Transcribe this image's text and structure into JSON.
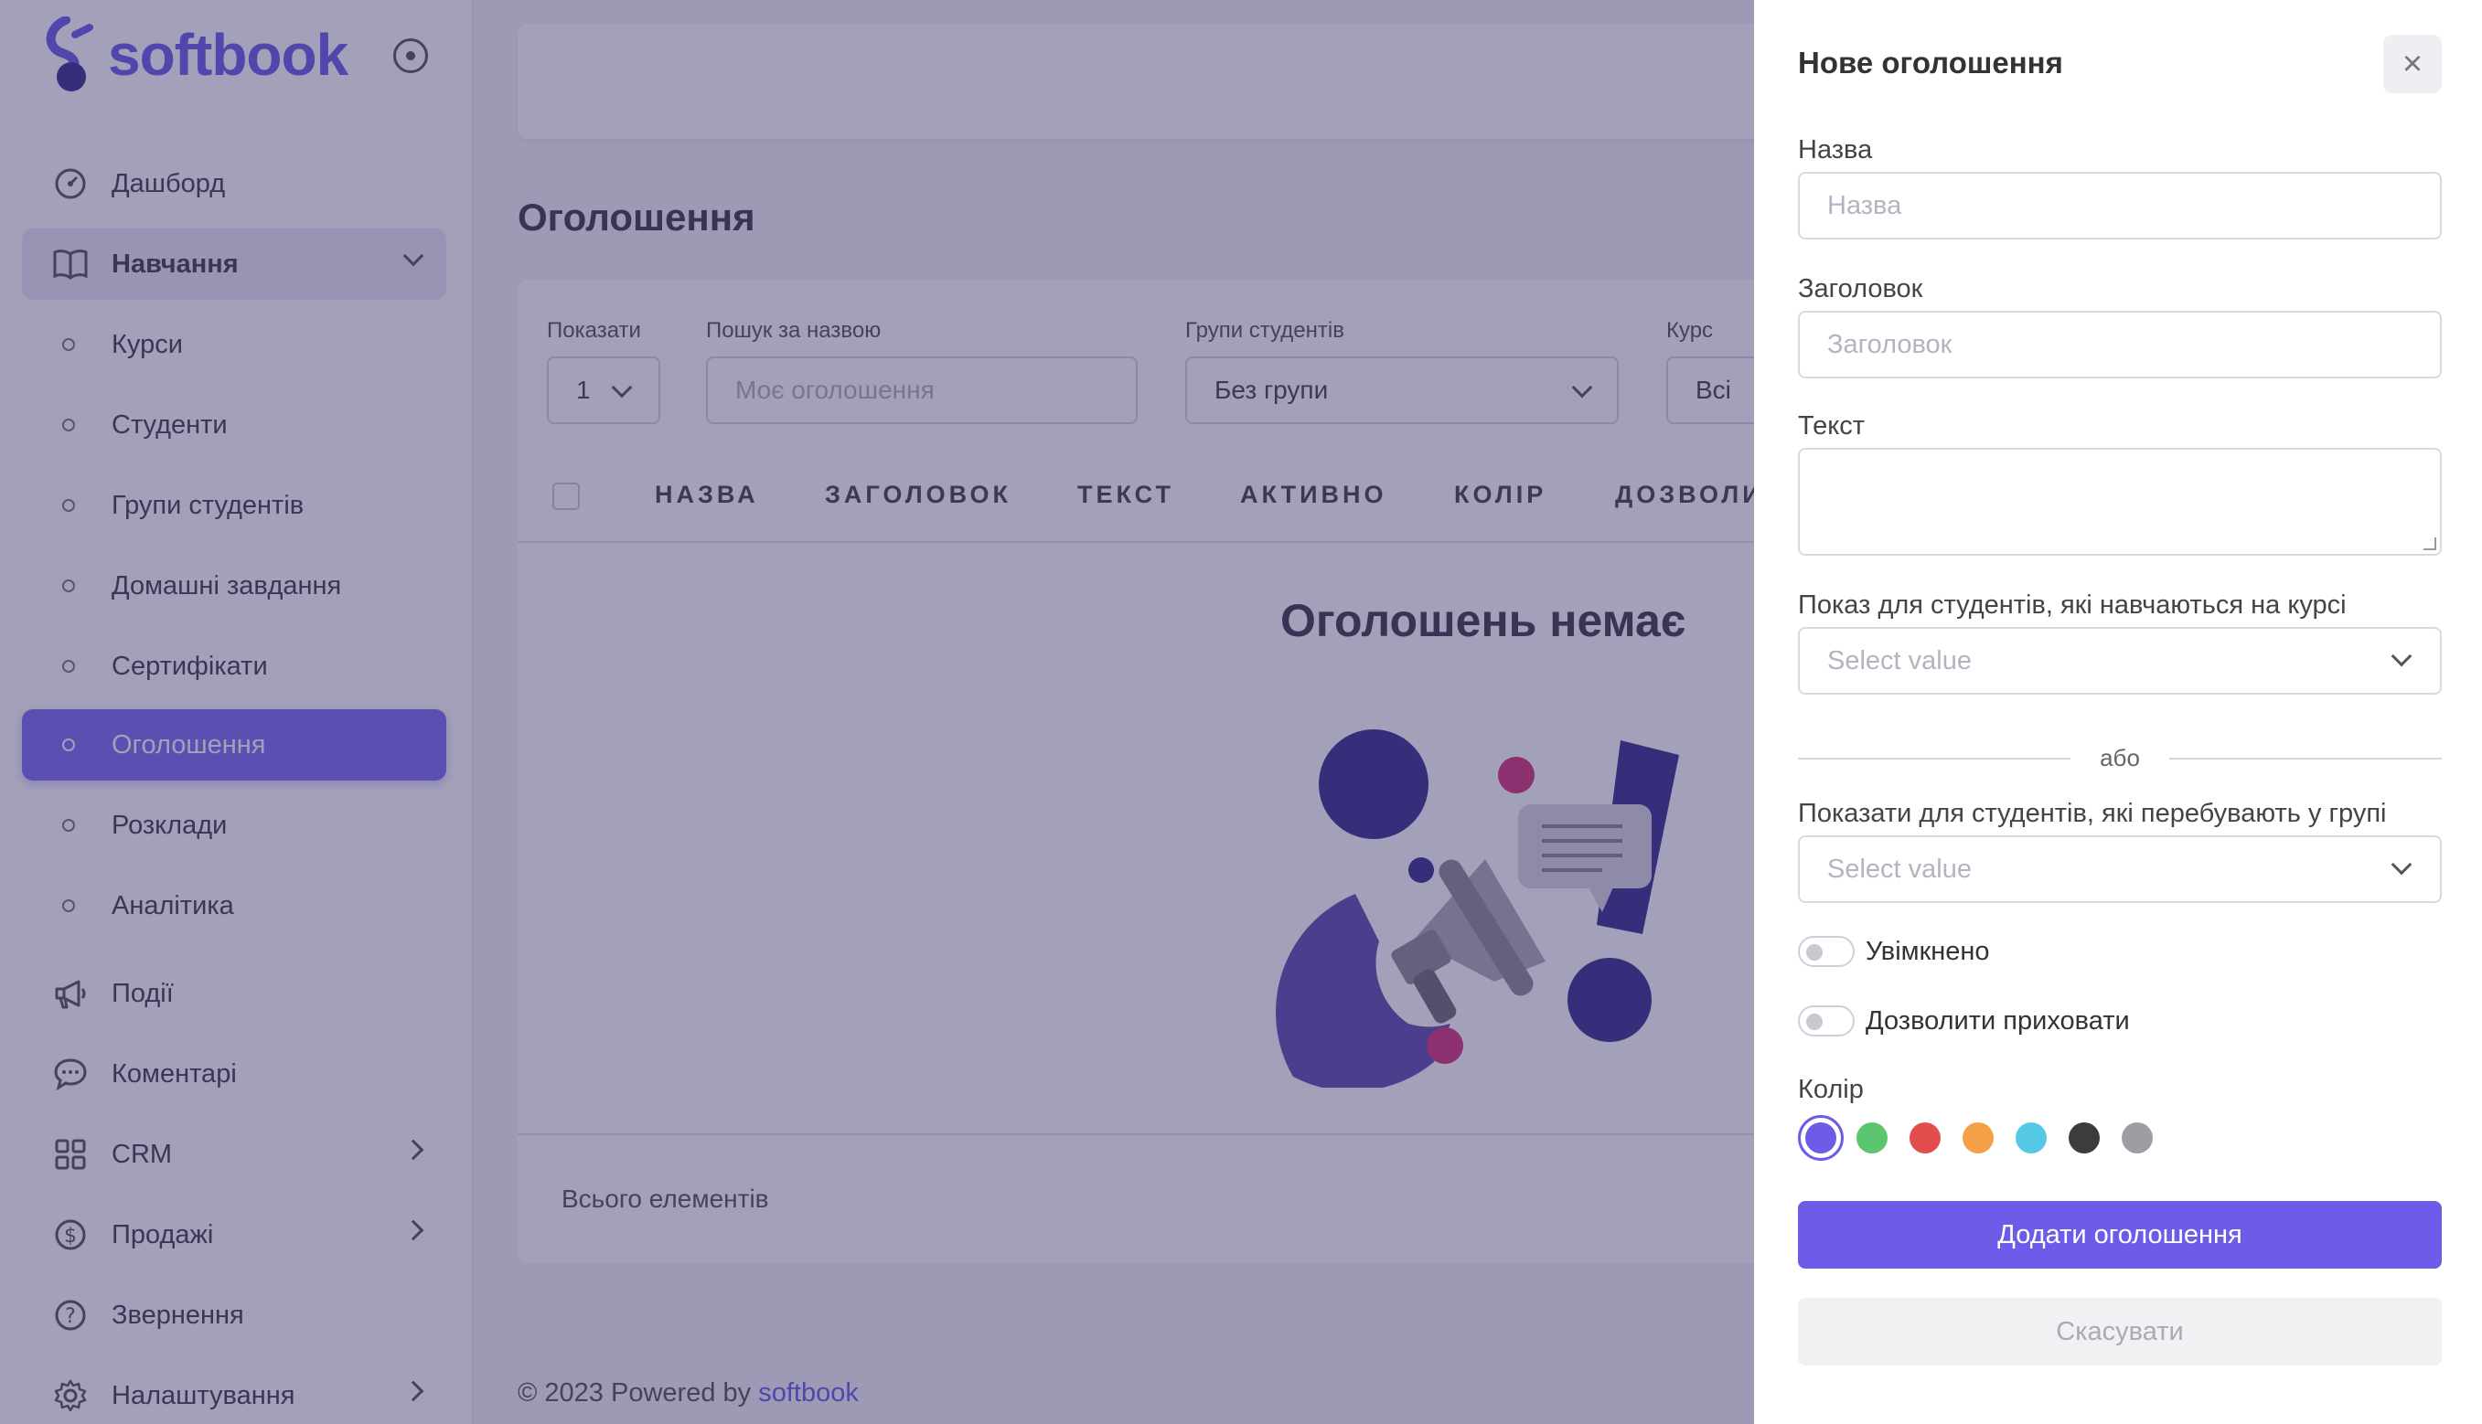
{
  "brand": {
    "name": "softbook",
    "accent": "#6c5ce7"
  },
  "sidebar": {
    "items": [
      {
        "label": "Дашборд",
        "icon": "dashboard-icon"
      },
      {
        "label": "Навчання",
        "icon": "book-icon",
        "expanded": true
      },
      {
        "label": "Курси"
      },
      {
        "label": "Студенти"
      },
      {
        "label": "Групи студентів"
      },
      {
        "label": "Домашні завдання"
      },
      {
        "label": "Сертифікати"
      },
      {
        "label": "Оголошення",
        "active": true
      },
      {
        "label": "Розклади"
      },
      {
        "label": "Аналітика"
      },
      {
        "label": "Події",
        "icon": "megaphone-icon"
      },
      {
        "label": "Коментарі",
        "icon": "comment-icon"
      },
      {
        "label": "CRM",
        "icon": "grid-icon"
      },
      {
        "label": "Продажі",
        "icon": "dollar-icon"
      },
      {
        "label": "Звернення",
        "icon": "help-icon"
      },
      {
        "label": "Налаштування",
        "icon": "gear-icon"
      }
    ]
  },
  "main": {
    "title": "Оголошення",
    "filters": {
      "show_label": "Показати",
      "show_value": "1",
      "search_label": "Пошук за назвою",
      "search_placeholder": "Моє оголошення",
      "groups_label": "Групи студентів",
      "groups_value": "Без групи",
      "course_label": "Курс",
      "course_value": "Всі"
    },
    "columns": [
      "НАЗВА",
      "ЗАГОЛОВОК",
      "ТЕКСТ",
      "АКТИВНО",
      "КОЛІР",
      "ДОЗВОЛИТ"
    ],
    "empty_text": "Оголошень немає",
    "total_label": "Всього елементів"
  },
  "footer": {
    "text": "© 2023 Powered by",
    "brand": "softbook"
  },
  "drawer": {
    "title": "Нове оголошення",
    "close_symbol": "×",
    "name_label": "Назва",
    "name_placeholder": "Назва",
    "heading_label": "Заголовок",
    "heading_placeholder": "Заголовок",
    "text_label": "Текст",
    "course_label": "Показ для студентів, які навчаються на курсі",
    "course_placeholder": "Select value",
    "or_label": "або",
    "group_label": "Показати для студентів, які перебувають у групі",
    "group_placeholder": "Select value",
    "enabled_label": "Увімкнено",
    "allow_hide_label": "Дозволити приховати",
    "color_label": "Колір",
    "colors": [
      "#6c5ce7",
      "#5cc56f",
      "#e24e4e",
      "#f5a047",
      "#55c8e6",
      "#3c3c3c",
      "#9d9da3"
    ],
    "selected_color": "#6c5ce7",
    "submit_label": "Додати оголошення",
    "cancel_label": "Скасувати"
  }
}
